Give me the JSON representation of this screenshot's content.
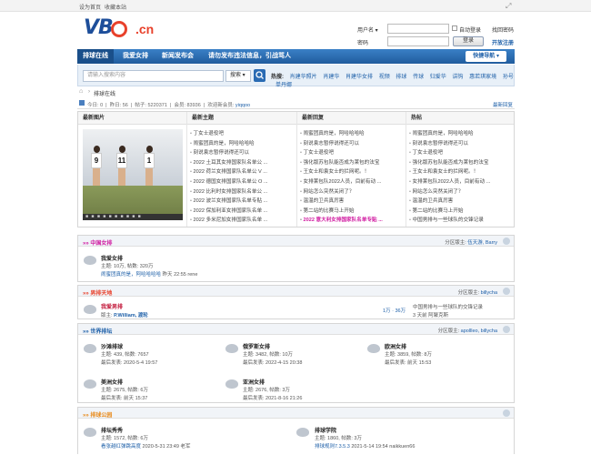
{
  "topbar": {
    "set_home": "设为首页",
    "bookmark": "收藏本站"
  },
  "logo": {
    "text_left": "VB",
    "text_right": ".cn"
  },
  "login": {
    "username_label": "用户名",
    "password_label": "密码",
    "auto_login": "自动登录",
    "find_password": "找回密码",
    "login_btn": "登录",
    "register": "开放注册"
  },
  "nav": {
    "items": [
      "排球在线",
      "我爱女排",
      "新闻发布会",
      "请勿发布违法信息，引战骂人"
    ],
    "quick": "快捷导航"
  },
  "search": {
    "placeholder": "请输入搜索内容",
    "scope": "搜索",
    "hot_label": "热搜:",
    "hot_items": [
      "肖建华照片",
      "肖建华",
      "肖建华女排",
      "视频",
      "排球",
      "传球",
      "归爱华",
      "讲钩",
      "惠若琪家境",
      "孙号",
      "单丹娜"
    ]
  },
  "breadcrumb": {
    "current": "排球在线"
  },
  "stats": {
    "today_label": "今日:",
    "today": "0",
    "yesterday_label": "昨日:",
    "yesterday": "56",
    "posts_label": "帖子:",
    "posts": "5220371",
    "members_label": "会员:",
    "members": "83936",
    "newest_label": "欢迎新会员:",
    "newest": "yiqqoo",
    "latest_reply": "最新回复"
  },
  "panel": {
    "headers": [
      "最新图片",
      "最新主题",
      "最新回复",
      "热帖"
    ],
    "photo_numbers": [
      "9",
      "11",
      "1"
    ],
    "topics": [
      "丁女士退役吧",
      "闹蜜团真的是，阿哈哈哈哈",
      "刻说袁志暂停说得还可以",
      "2022 土耳其女排国家队名单公 ...",
      "2022 荷兰女排国家队名单公 V ...",
      "2022 德国女排国家队名单公 O ...",
      "2022 比利时女排国家队名单公 ...",
      "2022 波兰女排国家队名单专贴 ...",
      "2022 保加利亚女排国家队名单 ...",
      "2022 多米尼加女排国家队名单 ..."
    ],
    "replies": [
      "闹蜜团真的是，阿哈哈哈哈",
      "刻说袁志暂停说得还可以",
      "丁女士退役吧",
      "强化版苏包队能否成为莱包的法宝",
      "王女士和袁女士的拦网呢。！",
      "女排莱包队2022人员，目前有动 ...",
      "网站怎么突然关闭了？",
      "温温的卫兵真厉害",
      "第二站的比赛马上开始",
      "2022 意大利女排国家队名单专贴 ..."
    ],
    "hot": [
      "闹蜜团真的是，阿哈哈哈哈",
      "刻说袁志暂停说得还可以",
      "丁女士退役吧",
      "强化版苏包队能否成为莱包的法宝",
      "王女士和袁女士的拦网呢。！",
      "女排莱包队2022人员，目前有动 ...",
      "网站怎么突然关闭了？",
      "温温的卫兵真厉害",
      "第二站的比赛马上开始",
      "中国男排与一些球队的交锋记录"
    ]
  },
  "sections": [
    {
      "title": "中国女排",
      "mod_label": "分区版主:",
      "mods": "伍天游, Barry",
      "forums": [
        {
          "name": "我爱女排",
          "meta": "主题: 10万, 帖数: 320万",
          "last_link": "闹蜜团真的是，阿哈哈哈哈",
          "last_time": "昨天 22:55 rene"
        }
      ]
    },
    {
      "title": "男排天地",
      "mod_label": "分区版主:",
      "mods": "billycha",
      "forums": [
        {
          "name": "我爱男排",
          "meta_label": "版主:",
          "meta": "P.William, 渡轮",
          "counts": "1万 · 36万",
          "last_link": "中国男排与一些球队的交锋记录",
          "last_time": "3 天前 阿聚克斯"
        }
      ]
    },
    {
      "title": "世界排坛",
      "mod_label": "分区版主:",
      "mods": "apollleo, billycha",
      "forums": [
        {
          "name": "沙滩排球",
          "meta": "主题: 439, 帖数: 7657",
          "last": "最后发表: 2020-5-4 19:57"
        },
        {
          "name": "俄罗斯女排",
          "meta": "主题: 3482, 帖数: 10万",
          "last": "最后发表: 2022-4-15 20:38"
        },
        {
          "name": "欧洲女排",
          "meta": "主题: 3859, 帖数: 8万",
          "last": "最后发表: 前天 15:53"
        },
        {
          "name": "美洲女排",
          "meta": "主题: 2675, 帖数: 6万",
          "last": "最后发表: 前天 15:37"
        },
        {
          "name": "亚洲女排",
          "meta": "主题: 2676, 帖数: 3万",
          "last": "最后发表: 2021-8-16 21:26"
        }
      ]
    },
    {
      "title": "排球公园",
      "forums": [
        {
          "name": "排坛秀秀",
          "meta": "主题: 1572, 帖数: 6万",
          "last_link": "看张越红弹跳高度",
          "last_time": "2020-5-31 23:49 老军"
        },
        {
          "name": "排球学院",
          "meta": "主题: 1860, 帖数: 3万",
          "last_link": "排球规则7.3.5.3",
          "last_time": "2021-5-14 19:54 naikkuen66"
        }
      ]
    }
  ]
}
